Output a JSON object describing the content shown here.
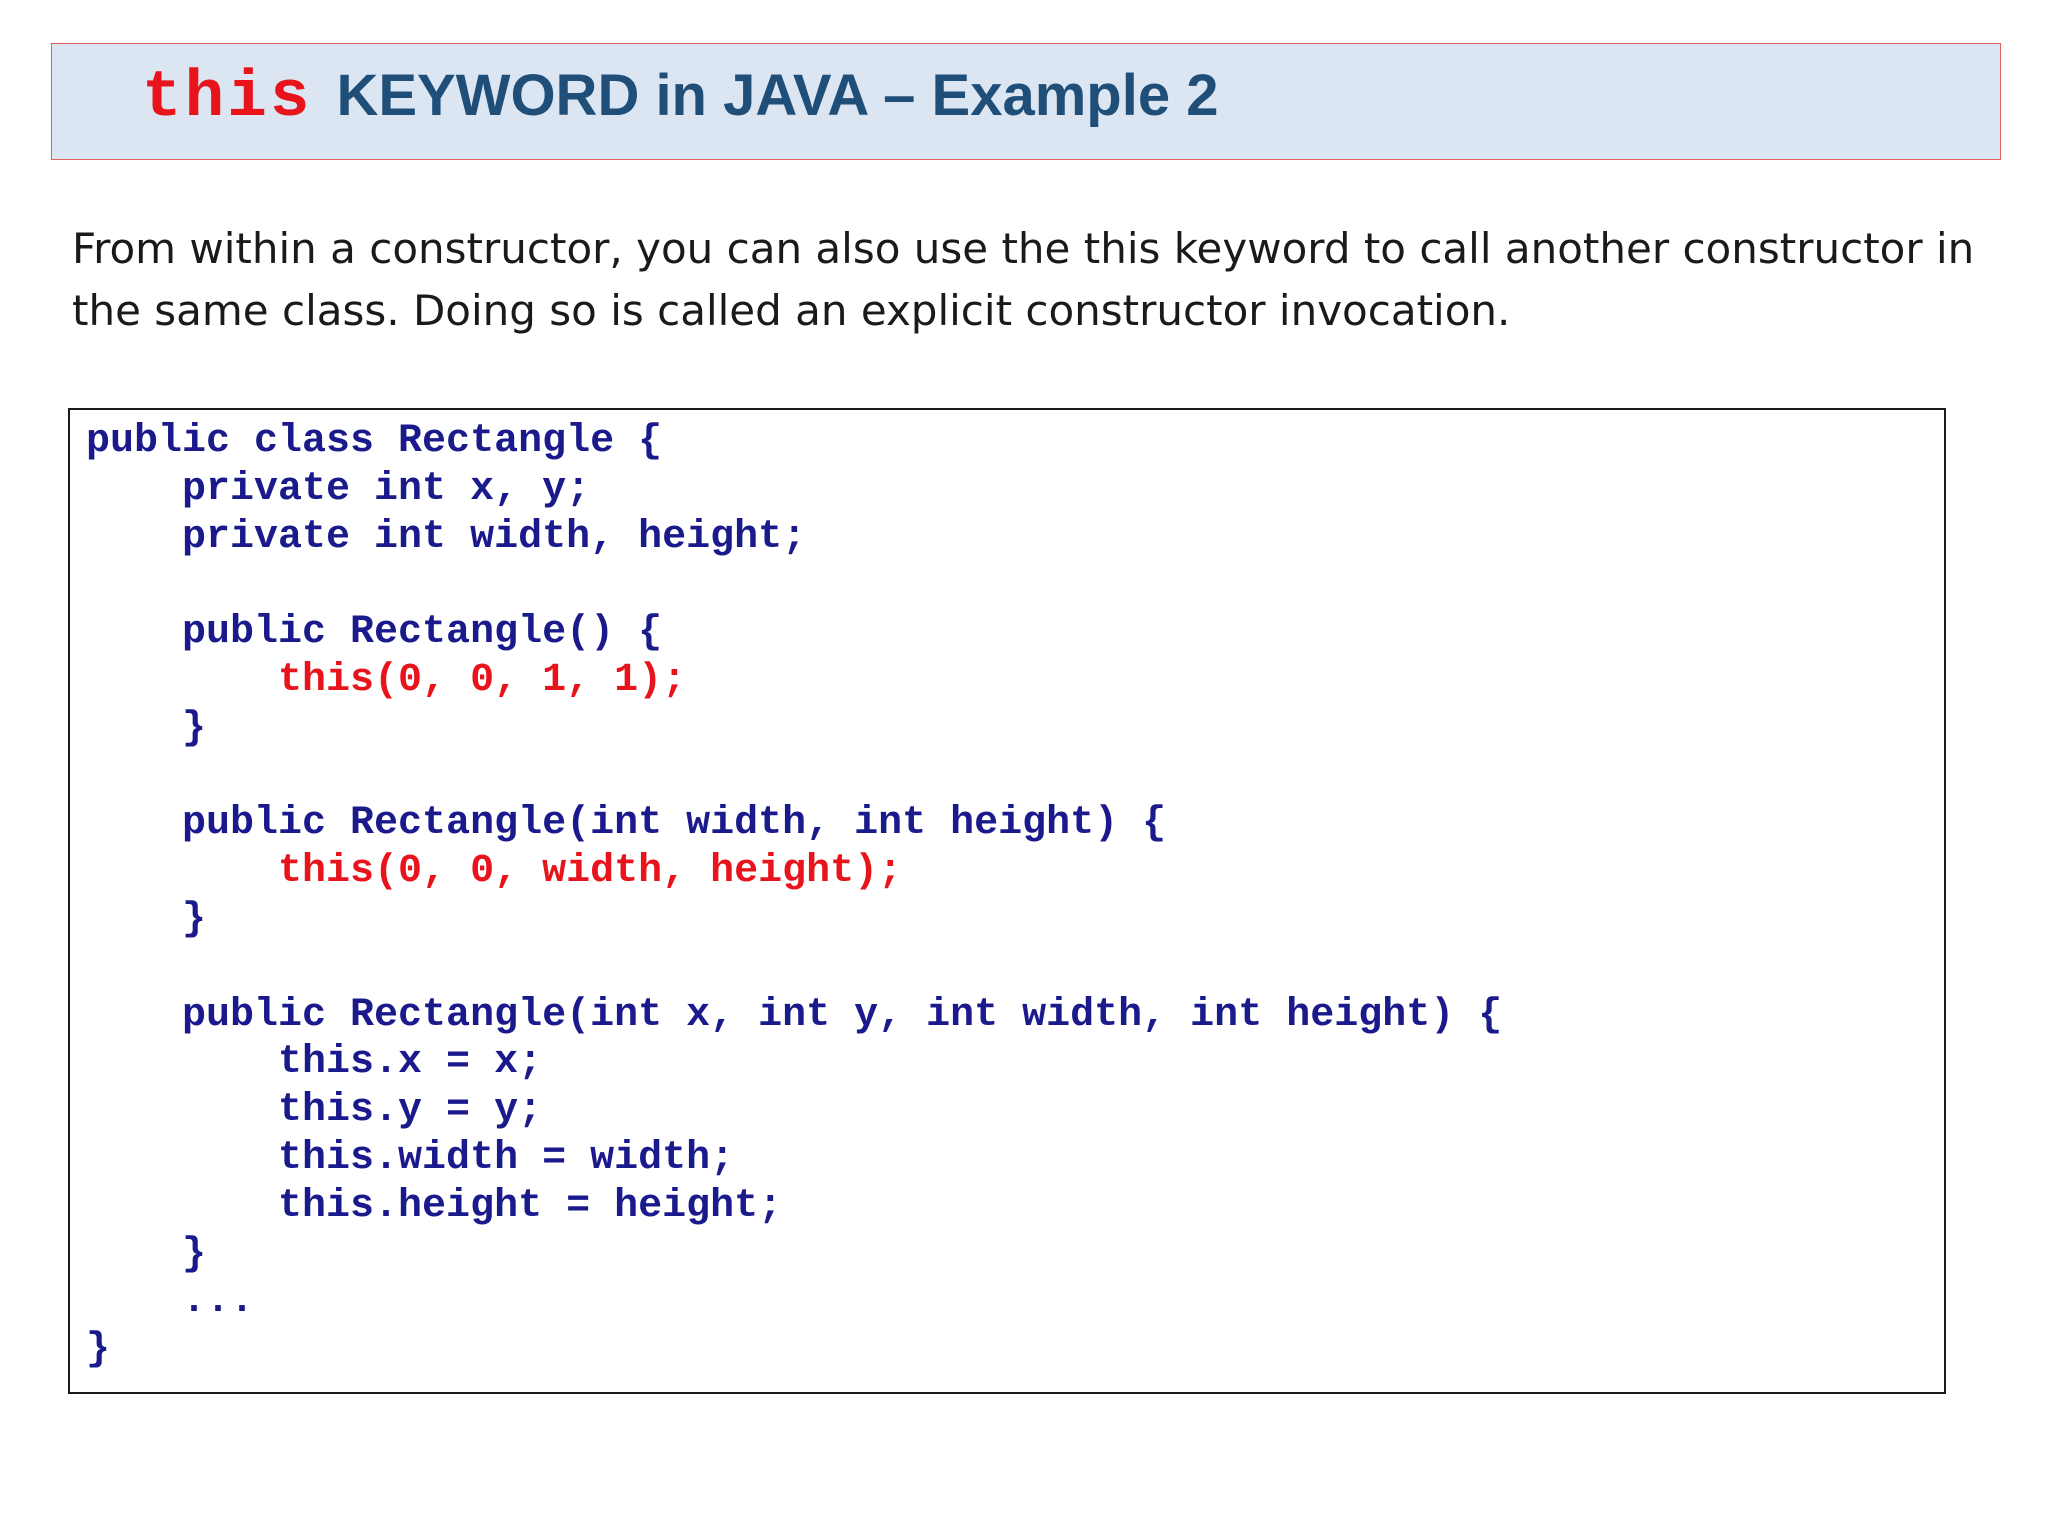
{
  "slide": {
    "title_keyword": "this",
    "title_rest": "KEYWORD in JAVA – Example 2",
    "intro_line_1": "From within a constructor, you can also use the this keyword to call another constructor in",
    "intro_line_2": "the same class. Doing so is called an explicit constructor invocation."
  },
  "code": {
    "lines": [
      {
        "text": "public class Rectangle {",
        "highlight": false
      },
      {
        "text": "    private int x, y;",
        "highlight": false
      },
      {
        "text": "    private int width, height;",
        "highlight": false
      },
      {
        "text": "",
        "highlight": false
      },
      {
        "text": "    public Rectangle() {",
        "highlight": false
      },
      {
        "text": "        this(0, 0, 1, 1);",
        "highlight": true
      },
      {
        "text": "    }",
        "highlight": false
      },
      {
        "text": "",
        "highlight": false
      },
      {
        "text": "    public Rectangle(int width, int height) {",
        "highlight": false
      },
      {
        "text": "        this(0, 0, width, height);",
        "highlight": true
      },
      {
        "text": "    }",
        "highlight": false
      },
      {
        "text": "",
        "highlight": false
      },
      {
        "text": "    public Rectangle(int x, int y, int width, int height) {",
        "highlight": false
      },
      {
        "text": "        this.x = x;",
        "highlight": false
      },
      {
        "text": "        this.y = y;",
        "highlight": false
      },
      {
        "text": "        this.width = width;",
        "highlight": false
      },
      {
        "text": "        this.height = height;",
        "highlight": false
      },
      {
        "text": "    }",
        "highlight": false
      },
      {
        "text": "    ...",
        "highlight": false
      },
      {
        "text": "}",
        "highlight": false
      }
    ]
  },
  "colors": {
    "keyword_red": "#e8141b",
    "title_blue": "#1f4e79",
    "code_blue": "#1a1a8c",
    "title_bar_bg": "#dce6f2"
  }
}
